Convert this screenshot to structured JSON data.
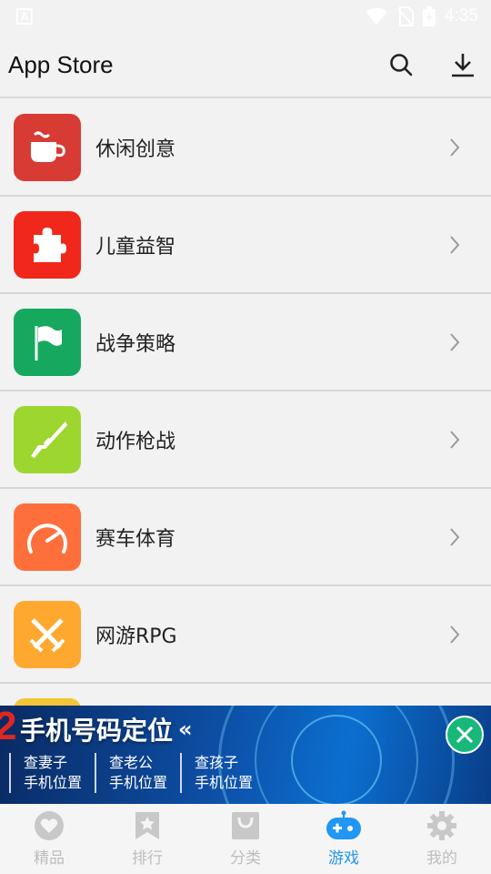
{
  "status_bar": {
    "time": "4:35",
    "left_icon": "A"
  },
  "app_bar": {
    "title": "App Store",
    "icons": [
      "search-icon",
      "download-icon"
    ]
  },
  "categories": [
    {
      "label": "休闲创意",
      "color": "#d83a34",
      "icon": "teacup-icon"
    },
    {
      "label": "儿童益智",
      "color": "#f0271a",
      "icon": "puzzle-icon"
    },
    {
      "label": "战争策略",
      "color": "#16a85e",
      "icon": "flag-icon"
    },
    {
      "label": "动作枪战",
      "color": "#9ed630",
      "icon": "rifle-icon"
    },
    {
      "label": "赛车体育",
      "color": "#ff6f3c",
      "icon": "speedometer-icon"
    },
    {
      "label": "网游RPG",
      "color": "#ffa82f",
      "icon": "crossed-swords-icon"
    }
  ],
  "partial_category_color": "#f4c534",
  "ad": {
    "number": "2",
    "title": "手机号码定位",
    "arrows": "«",
    "options": [
      {
        "line1": "查妻子",
        "line2": "手机位置"
      },
      {
        "line1": "查老公",
        "line2": "手机位置"
      },
      {
        "line1": "查孩子",
        "line2": "手机位置"
      }
    ]
  },
  "bottom_nav": [
    {
      "label": "精品",
      "icon": "heart-icon",
      "active": false
    },
    {
      "label": "排行",
      "icon": "ranking-bookmark-icon",
      "active": false
    },
    {
      "label": "分类",
      "icon": "category-bag-icon",
      "active": false
    },
    {
      "label": "游戏",
      "icon": "gamepad-icon",
      "active": true
    },
    {
      "label": "我的",
      "icon": "settings-gear-icon",
      "active": false
    }
  ],
  "colors": {
    "accent": "#2196f3",
    "inactive": "#bdbdbd"
  }
}
